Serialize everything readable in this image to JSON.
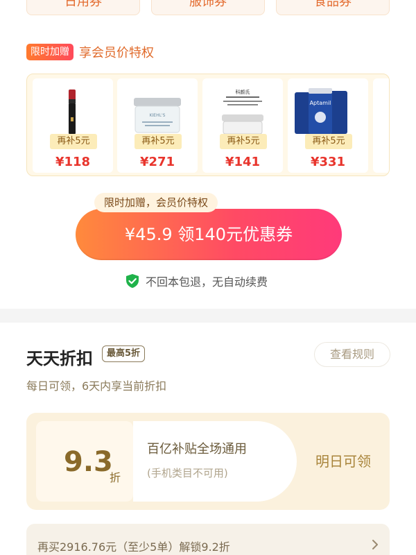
{
  "categories": [
    "日用券",
    "服饰券",
    "食品券"
  ],
  "member": {
    "tag": "限时加赠",
    "title": "享会员价特权",
    "products": [
      {
        "icon": "lipstick-image",
        "bonus": "再补5元",
        "price": "¥118"
      },
      {
        "icon": "cream-jar-image",
        "bonus": "再补5元",
        "price": "¥271"
      },
      {
        "icon": "skincare-jar-image",
        "bonus": "再补5元",
        "price": "¥141"
      },
      {
        "icon": "aptamil-formula-image",
        "bonus": "再补5元",
        "price": "¥331"
      }
    ],
    "jar_label_1": "KIEHL'S",
    "jar_label_2": "科颜氏",
    "formula_brand": "Aptamil"
  },
  "cta": {
    "hint": "限时加赠，会员价特权",
    "label": "¥45.9 领140元优惠券",
    "guarantee": "不回本包退，无自动续费"
  },
  "discount": {
    "title": "天天折扣",
    "badge": "最高5折",
    "rules_label": "查看规则",
    "subtitle": "每日可领，6天内享当前折扣",
    "card": {
      "value": "9.3",
      "unit": "折",
      "scope_title": "百亿补贴全场通用",
      "scope_note": "(手机类目不可用)",
      "action": "明日可领"
    },
    "unlock_text": "再买2916.76元（至少5单）解锁9.2折"
  },
  "colors": {
    "accent_red": "#e8342c",
    "accent_orange": "#ff8a3c",
    "gold": "#a8843a"
  }
}
